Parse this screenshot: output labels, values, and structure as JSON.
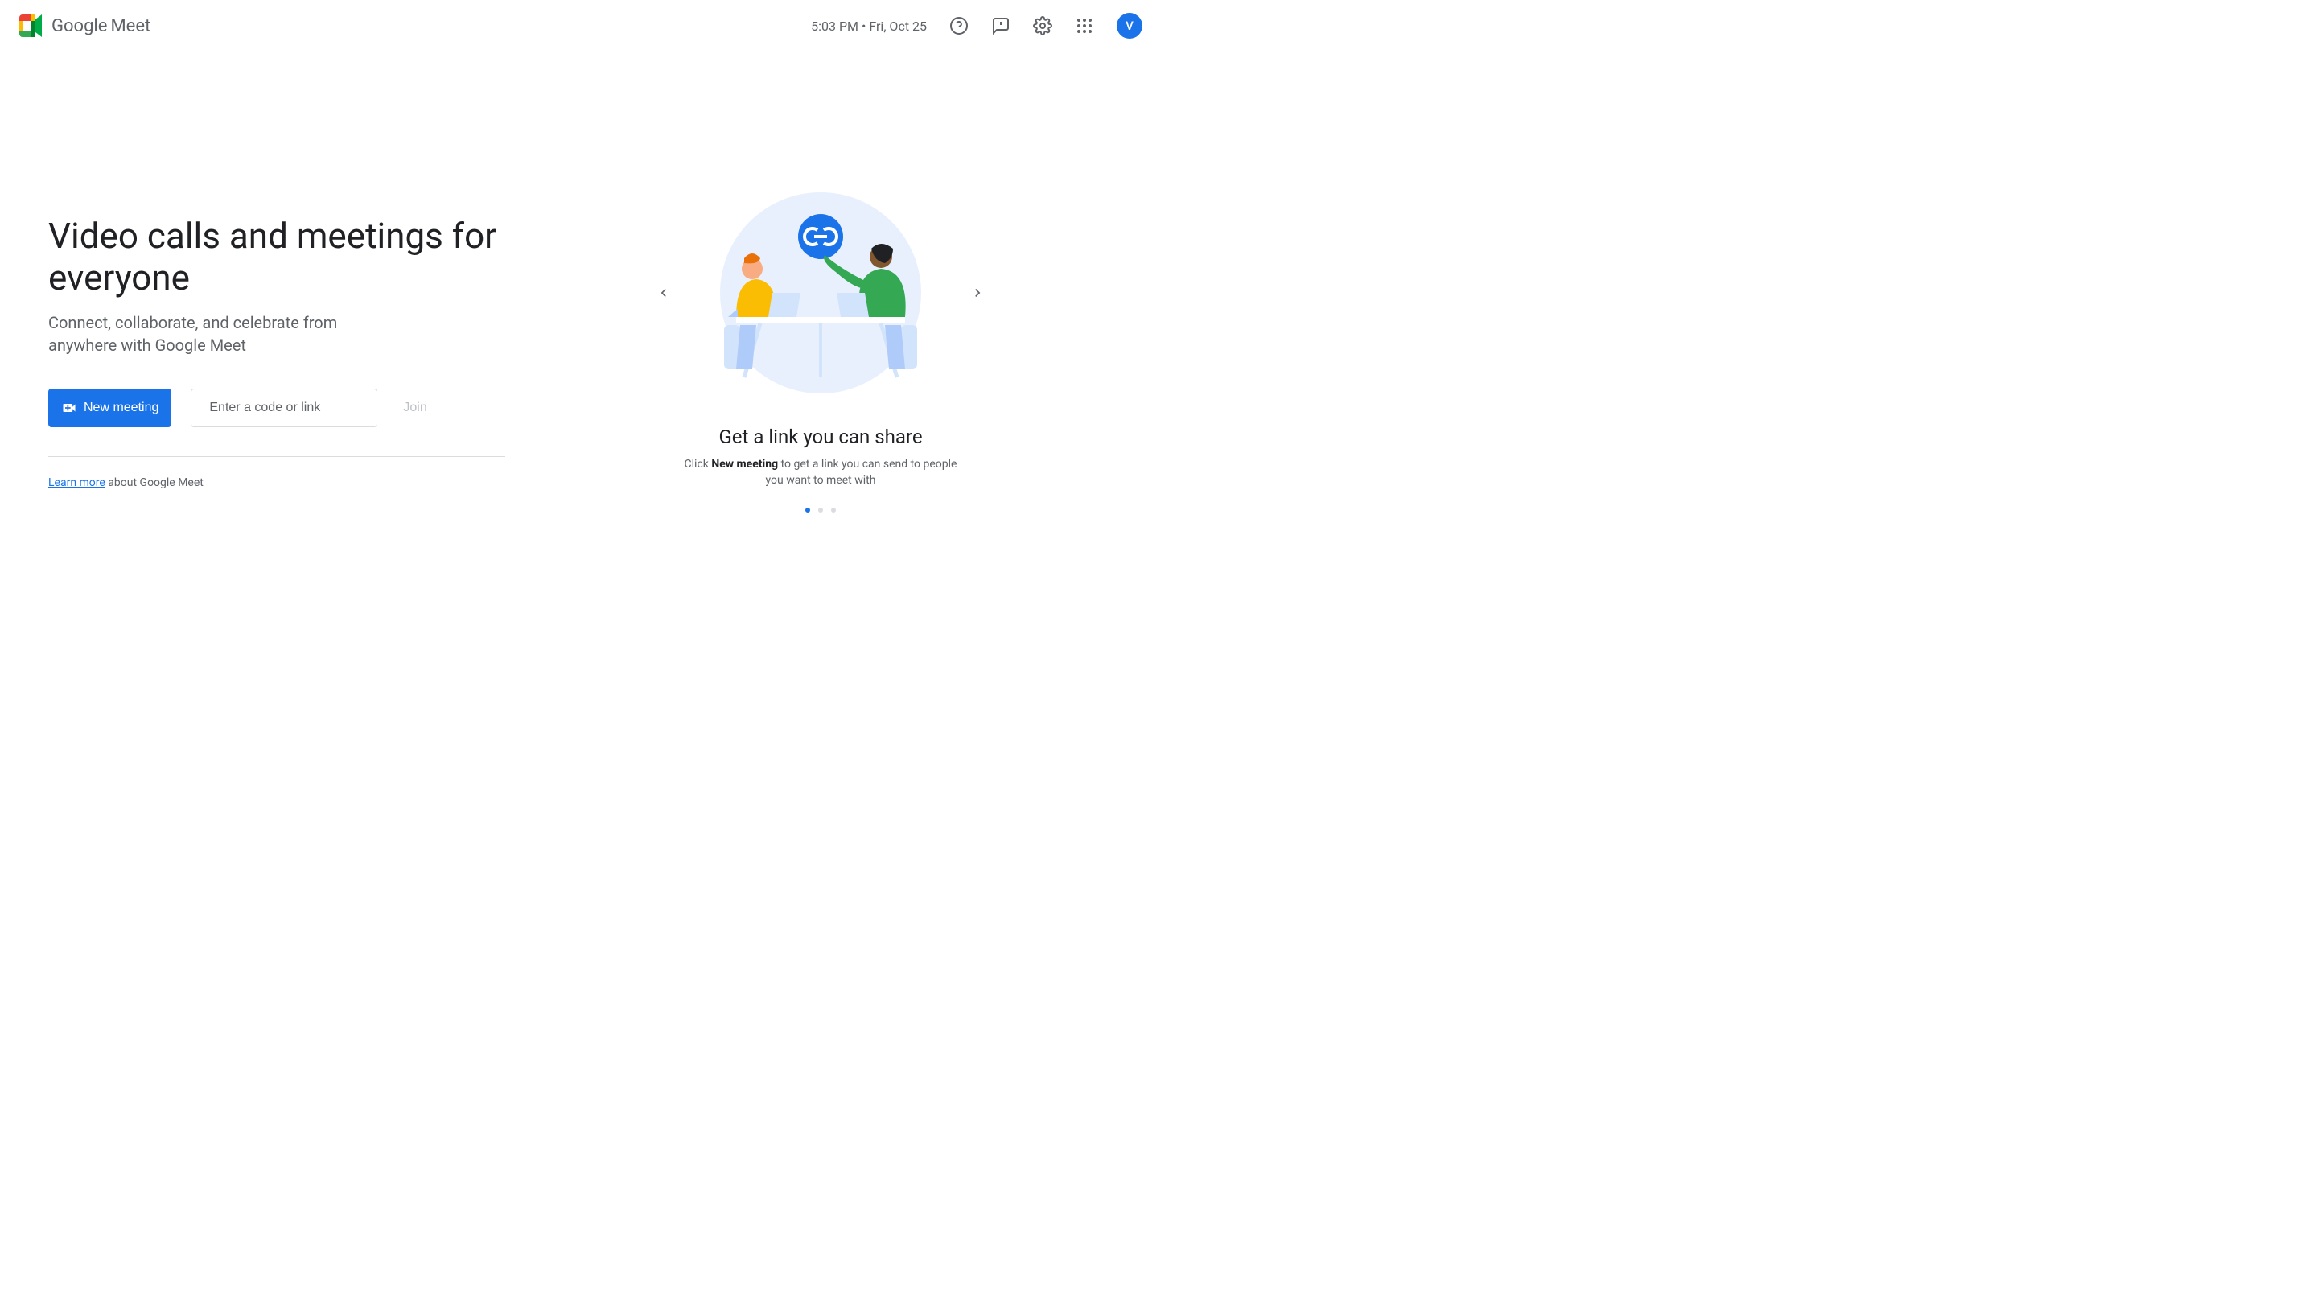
{
  "header": {
    "brand_google": "Google",
    "brand_meet": "Meet",
    "datetime": "5:03 PM • Fri, Oct 25",
    "avatar_initial": "V"
  },
  "main": {
    "headline": "Video calls and meetings for everyone",
    "subheadline": "Connect, collaborate, and celebrate from anywhere with Google Meet",
    "new_meeting_label": "New meeting",
    "code_placeholder": "Enter a code or link",
    "join_label": "Join",
    "learn_more_link": "Learn more",
    "learn_more_suffix": " about Google Meet"
  },
  "carousel": {
    "title": "Get a link you can share",
    "desc_prefix": "Click ",
    "desc_bold": "New meeting",
    "desc_suffix": " to get a link you can send to people you want to meet with",
    "active_dot": 0,
    "total_dots": 3
  }
}
